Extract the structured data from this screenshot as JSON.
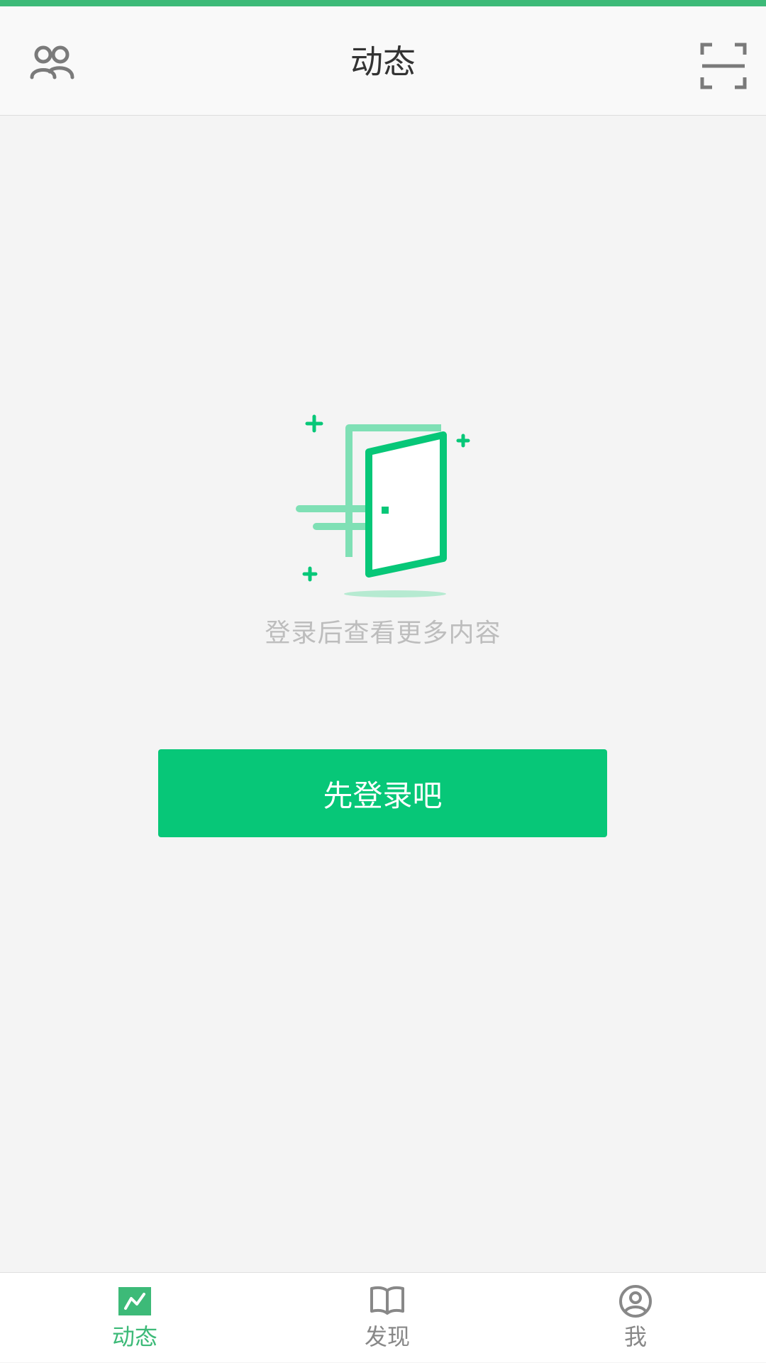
{
  "header": {
    "title": "动态"
  },
  "main": {
    "hint_text": "登录后查看更多内容",
    "login_button_label": "先登录吧"
  },
  "bottom_nav": {
    "items": [
      {
        "label": "动态",
        "icon": "feed-icon",
        "active": true
      },
      {
        "label": "发现",
        "icon": "book-icon",
        "active": false
      },
      {
        "label": "我",
        "icon": "profile-icon",
        "active": false
      }
    ]
  },
  "colors": {
    "accent": "#07c778",
    "status_strip": "#3dba78",
    "nav_active": "#3dba78",
    "nav_inactive": "#888888",
    "icon_gray": "#7a7a7a"
  }
}
